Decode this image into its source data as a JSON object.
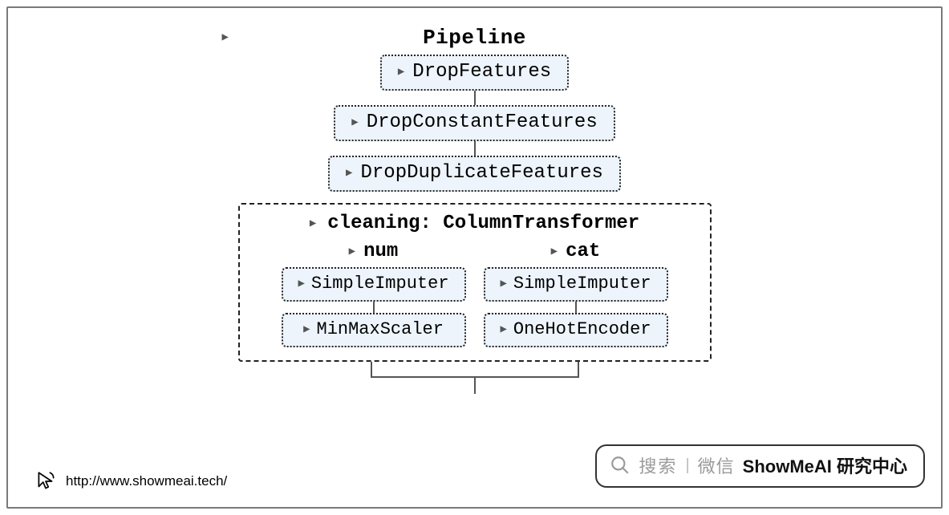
{
  "pipeline": {
    "title": "Pipeline",
    "steps": [
      {
        "label": "DropFeatures"
      },
      {
        "label": "DropConstantFeatures"
      },
      {
        "label": "DropDuplicateFeatures"
      }
    ],
    "column_transformer": {
      "title": "cleaning: ColumnTransformer",
      "columns": [
        {
          "name": "num",
          "steps": [
            {
              "label": "SimpleImputer"
            },
            {
              "label": "MinMaxScaler"
            }
          ]
        },
        {
          "name": "cat",
          "steps": [
            {
              "label": "SimpleImputer"
            },
            {
              "label": "OneHotEncoder"
            }
          ]
        }
      ]
    }
  },
  "search_pill": {
    "hint1": "搜索",
    "hint2": "微信",
    "brand": "ShowMeAI 研究中心"
  },
  "footer": {
    "url": "http://www.showmeai.tech/"
  }
}
